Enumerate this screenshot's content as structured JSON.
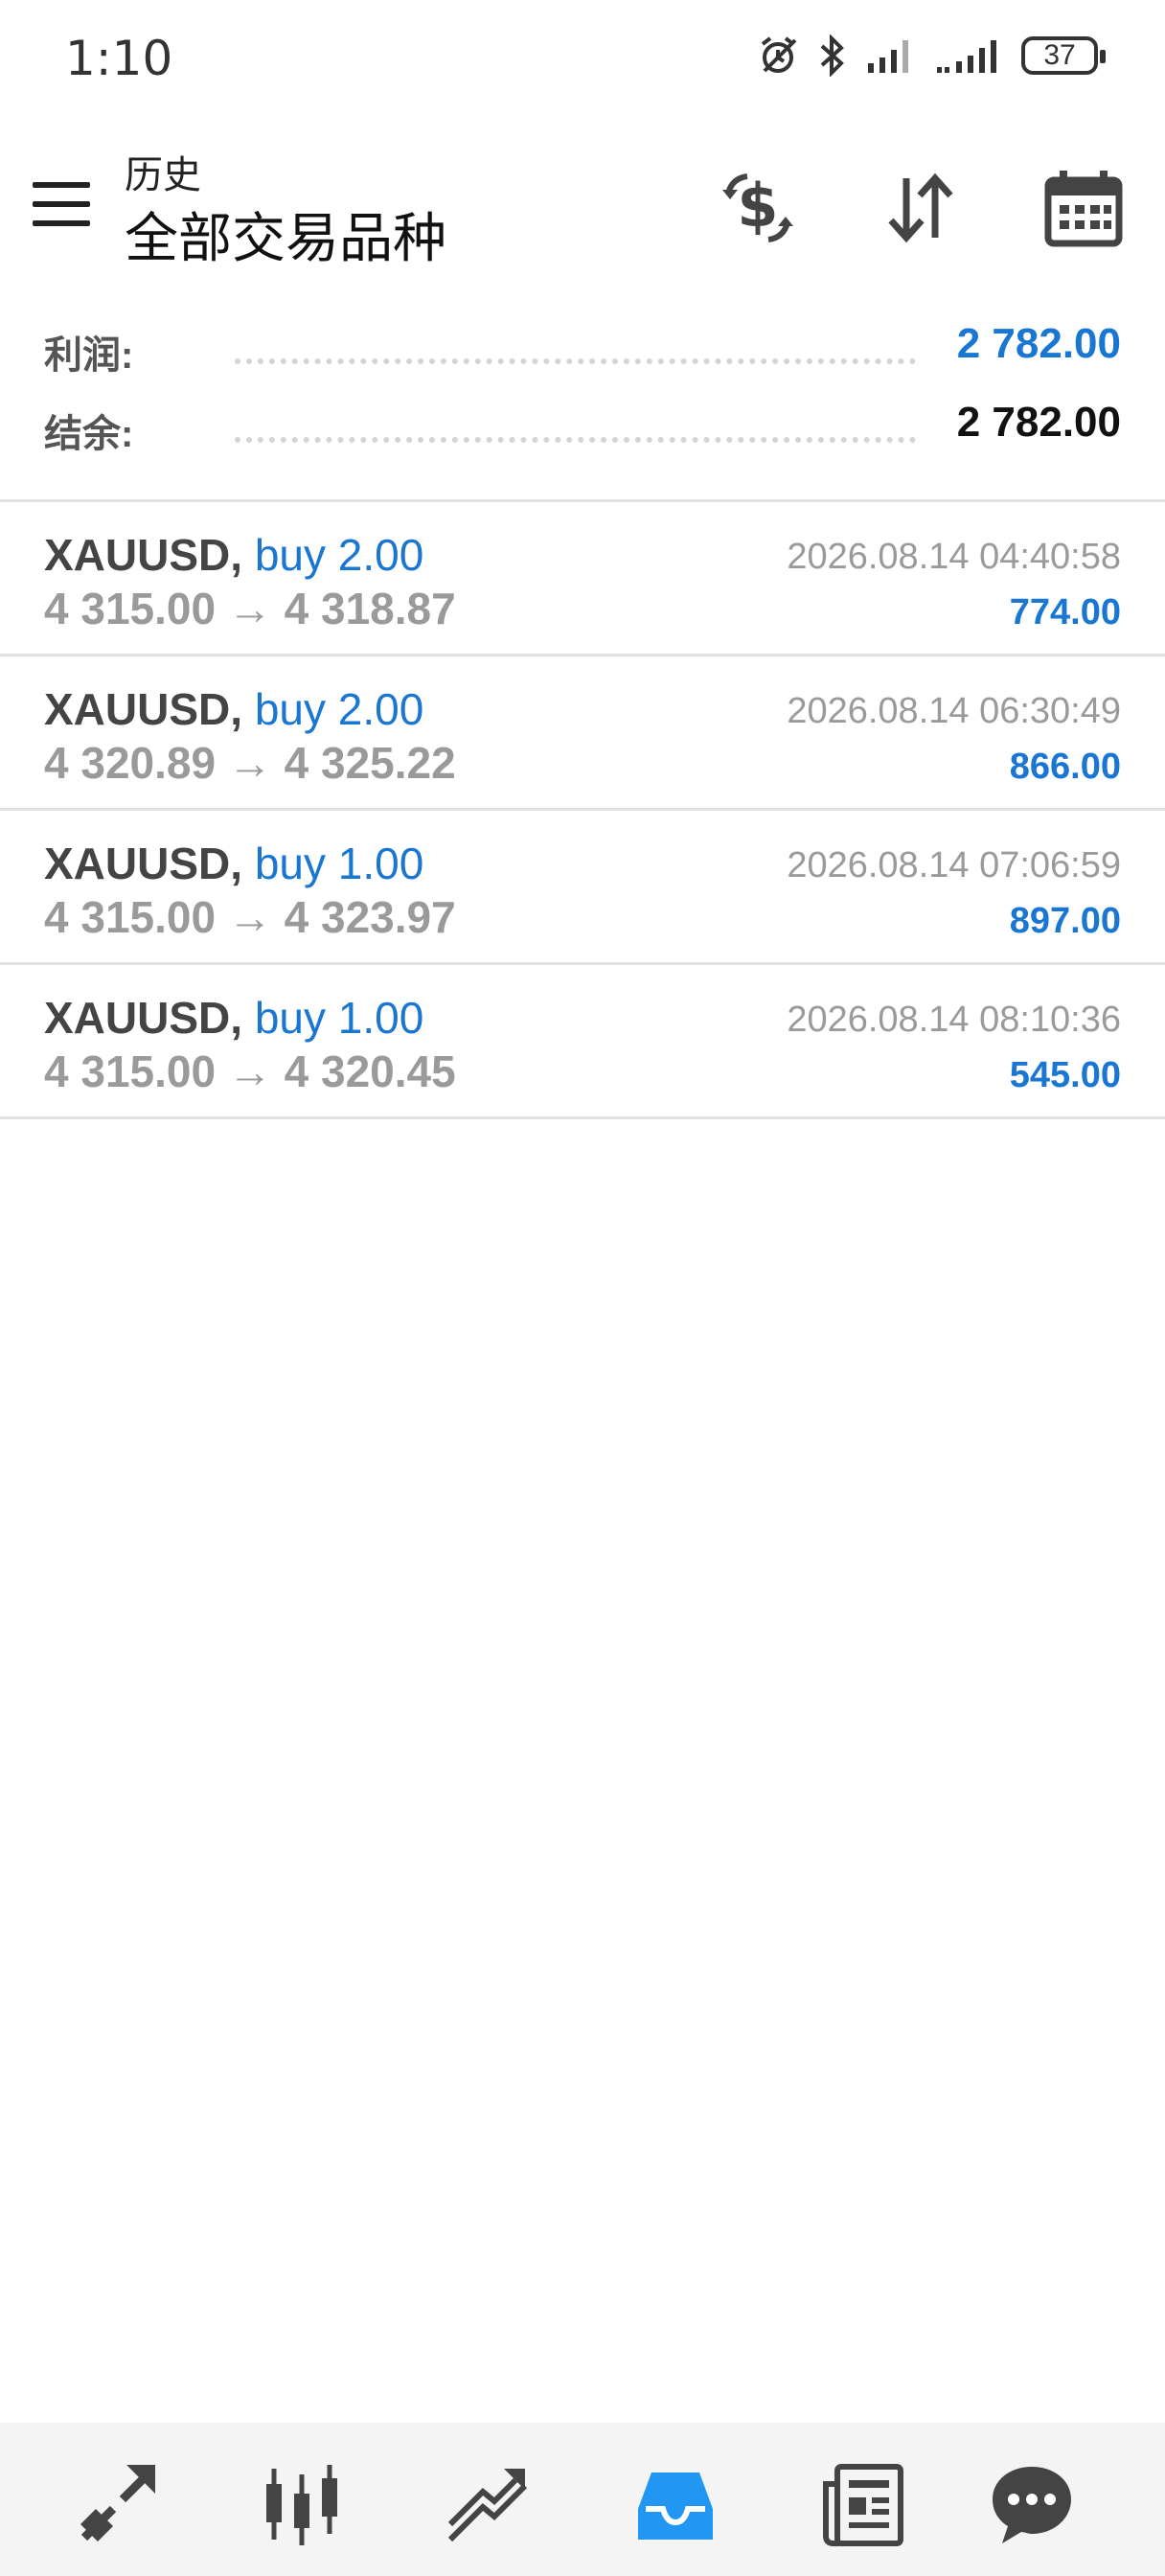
{
  "status_bar": {
    "time": "1:10",
    "battery": "37"
  },
  "header": {
    "title_small": "历史",
    "title_main": "全部交易品种"
  },
  "summary": [
    {
      "label": "利润:",
      "value": "2 782.00",
      "color": "#1976d2"
    },
    {
      "label": "结余:",
      "value": "2 782.00",
      "color": "#111111"
    }
  ],
  "trades": [
    {
      "symbol": "XAUUSD,",
      "side": "buy 2.00",
      "prices": "4 315.00 → 4 318.87",
      "datetime": "2026.08.14 04:40:58",
      "profit": "774.00"
    },
    {
      "symbol": "XAUUSD,",
      "side": "buy 2.00",
      "prices": "4 320.89 → 4 325.22",
      "datetime": "2026.08.14 06:30:49",
      "profit": "866.00"
    },
    {
      "symbol": "XAUUSD,",
      "side": "buy 1.00",
      "prices": "4 315.00 → 4 323.97",
      "datetime": "2026.08.14 07:06:59",
      "profit": "897.00"
    },
    {
      "symbol": "XAUUSD,",
      "side": "buy 1.00",
      "prices": "4 315.00 → 4 320.45",
      "datetime": "2026.08.14 08:10:36",
      "profit": "545.00"
    }
  ],
  "nav": {
    "items": [
      "quotes-icon",
      "chart-icon",
      "trade-icon",
      "history-icon",
      "news-icon",
      "chat-icon"
    ],
    "active": "history-icon",
    "active_color": "#2196f3",
    "inactive_color": "#444444"
  }
}
